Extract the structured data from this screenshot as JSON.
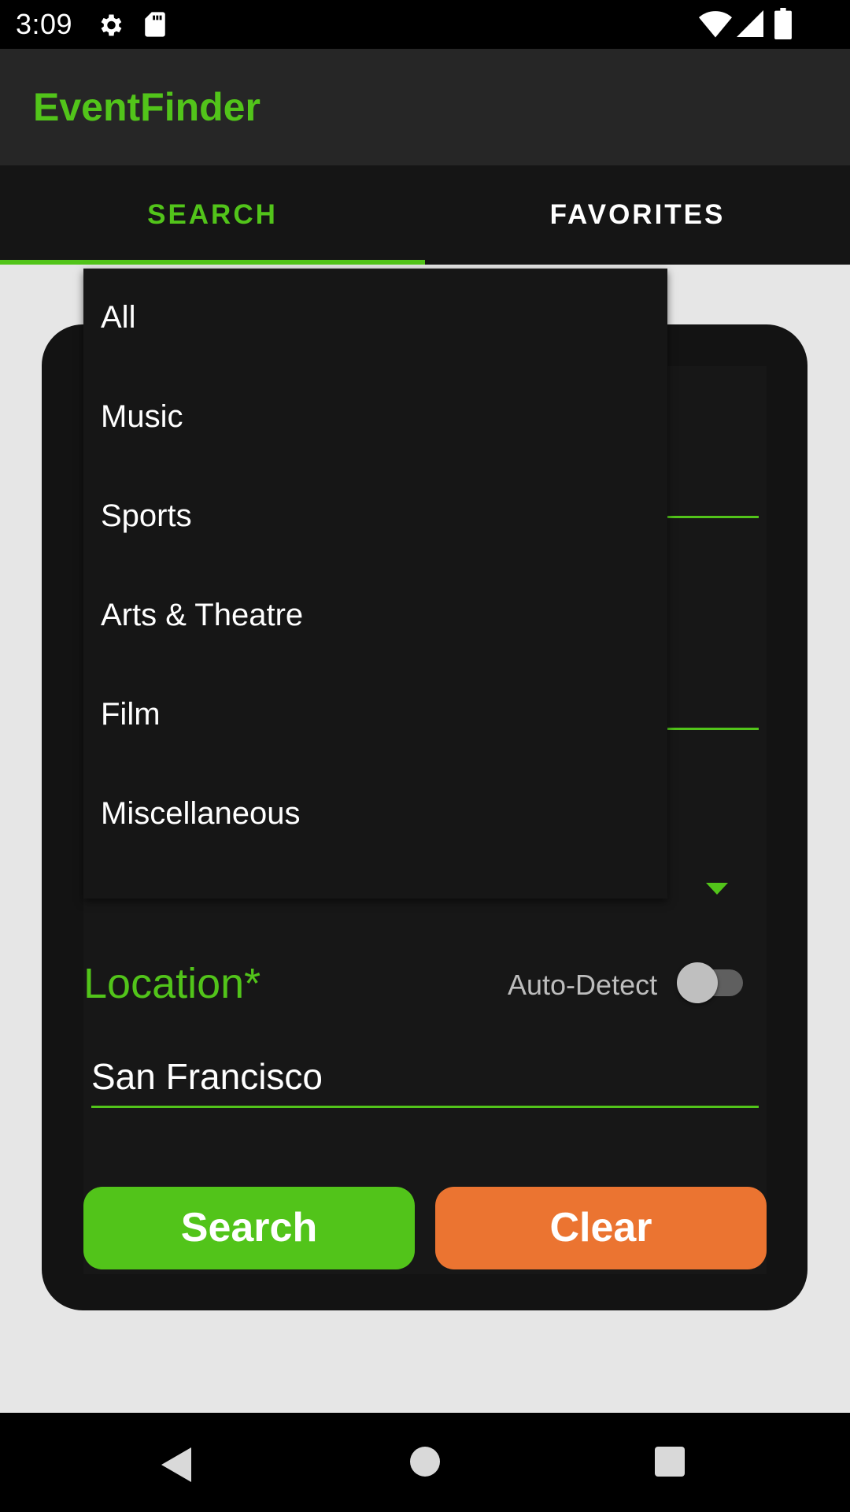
{
  "status_bar": {
    "time": "3:09",
    "left_icons": [
      "gear-icon",
      "sd-card-icon"
    ],
    "right_icons": [
      "wifi-icon",
      "cell-signal-icon",
      "battery-icon"
    ]
  },
  "app_bar": {
    "title": "EventFinder"
  },
  "tabs": [
    {
      "label": "SEARCH",
      "active": true
    },
    {
      "label": "FAVORITES",
      "active": false
    }
  ],
  "category": {
    "selected": "All",
    "options": [
      "All",
      "Music",
      "Sports",
      "Arts & Theatre",
      "Film",
      "Miscellaneous"
    ]
  },
  "location": {
    "label": "Location*",
    "auto_detect_label": "Auto-Detect",
    "auto_detect_on": false,
    "value": "San Francisco"
  },
  "buttons": {
    "search": "Search",
    "clear": "Clear"
  },
  "colors": {
    "accent": "#52c41a",
    "clear_button": "#eb7431",
    "card": "#131313",
    "background": "#e6e6e6"
  },
  "nav_bar": {
    "icons": [
      "back-icon",
      "home-icon",
      "recent-apps-icon"
    ]
  }
}
